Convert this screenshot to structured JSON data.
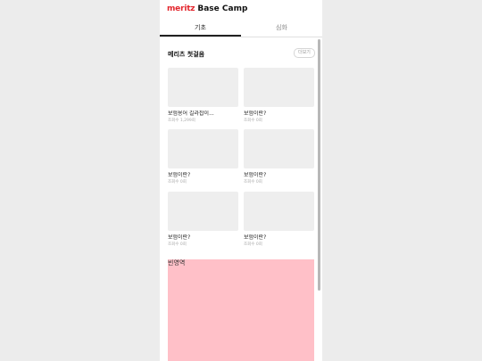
{
  "header": {
    "brand": "meritz",
    "title": "Base Camp"
  },
  "tabs": [
    {
      "label": "기초"
    },
    {
      "label": "심화"
    }
  ],
  "section": {
    "title": "메리츠 첫걸음",
    "more_label": "더보기"
  },
  "cards": [
    {
      "title": "보험용어 길라잡이...",
      "views": "조회수 1,299회"
    },
    {
      "title": "보험이란?",
      "views": "조회수 0회"
    },
    {
      "title": "보험이란?",
      "views": "조회수 0회"
    },
    {
      "title": "보험이란?",
      "views": "조회수 0회"
    },
    {
      "title": "보험이란?",
      "views": "조회수 0회"
    },
    {
      "title": "보험이란?",
      "views": "조회수 0회"
    }
  ],
  "banner": {
    "label": "빈영역",
    "color": "#ffc0c8"
  },
  "colors": {
    "brand": "#e3262d",
    "background": "#ececec"
  }
}
